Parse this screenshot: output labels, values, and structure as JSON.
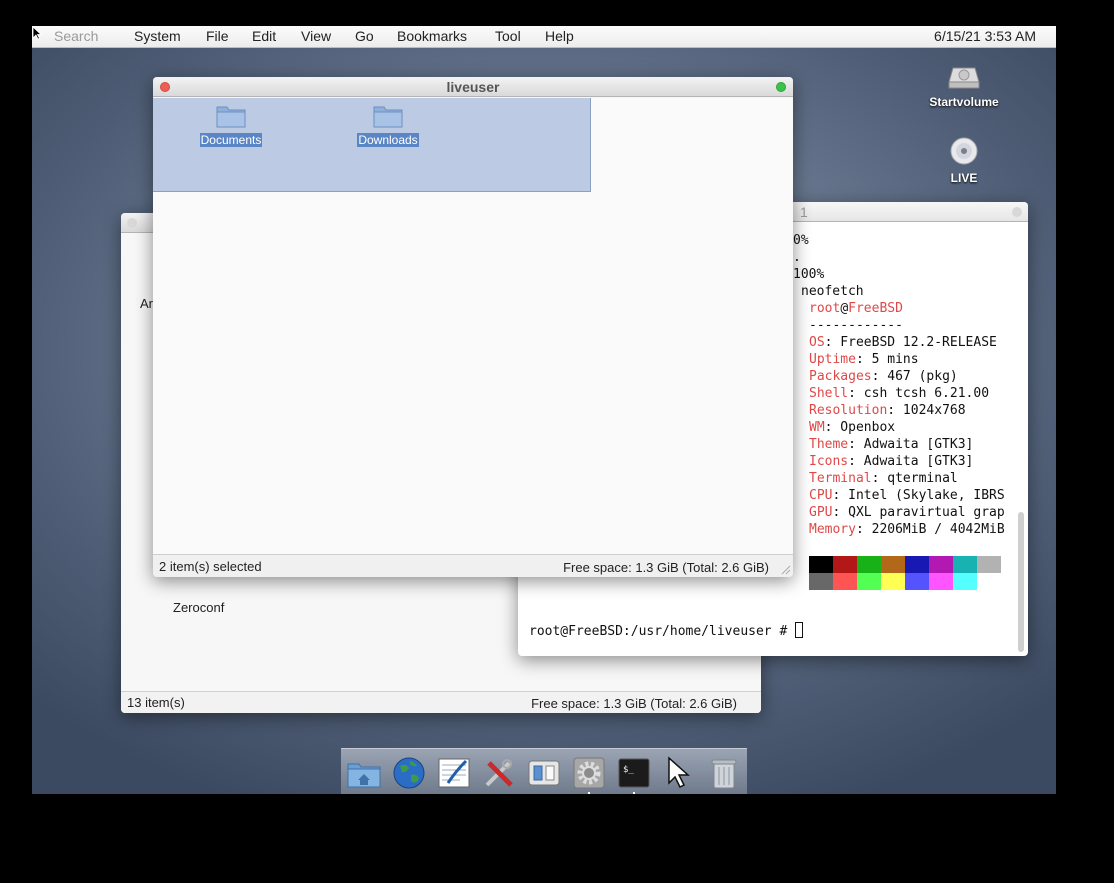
{
  "menubar": {
    "search_placeholder": "Search",
    "items": [
      "System",
      "File",
      "Edit",
      "View",
      "Go",
      "Bookmarks",
      "Tool",
      "Help"
    ],
    "clock": "6/15/21 3:53 AM"
  },
  "desktop_icons": [
    {
      "label": "Startvolume",
      "icon": "hard-drive-icon"
    },
    {
      "label": "LIVE",
      "icon": "cd-icon"
    }
  ],
  "front_window": {
    "title": "liveuser",
    "files": [
      {
        "name": "Documents",
        "icon": "folder-icon"
      },
      {
        "name": "Downloads",
        "icon": "folder-icon"
      }
    ],
    "status_left": "2 item(s) selected",
    "status_right": "Free space: 1.3 GiB (Total: 2.6 GiB)"
  },
  "back_window": {
    "partial_text_1": "Ar",
    "partial_text_2": "Zeroconf",
    "status_left": "13 item(s)",
    "status_right": "Free space: 1.3 GiB (Total: 2.6 GiB)"
  },
  "terminal": {
    "title_fragment": "1",
    "lines_pre": [
      "0%",
      ".",
      "100%",
      "neofetch"
    ],
    "user_host": {
      "user": "root",
      "at": "@",
      "host": "FreeBSD"
    },
    "separator": "------------",
    "info": [
      {
        "key": "OS",
        "value": ": FreeBSD 12.2-RELEASE"
      },
      {
        "key": "Uptime",
        "value": ": 5 mins"
      },
      {
        "key": "Packages",
        "value": ": 467 (pkg)"
      },
      {
        "key": "Shell",
        "value": ": csh tcsh 6.21.00"
      },
      {
        "key": "Resolution",
        "value": ": 1024x768"
      },
      {
        "key": "WM",
        "value": ": Openbox"
      },
      {
        "key": "Theme",
        "value": ": Adwaita [GTK3]"
      },
      {
        "key": "Icons",
        "value": ": Adwaita [GTK3]"
      },
      {
        "key": "Terminal",
        "value": ": qterminal"
      },
      {
        "key": "CPU",
        "value": ": Intel (Skylake, IBRS"
      },
      {
        "key": "GPU",
        "value": ": QXL paravirtual grap"
      },
      {
        "key": "Memory",
        "value": ": 2206MiB / 4042MiB"
      }
    ],
    "palette_row1": [
      "#000000",
      "#b21818",
      "#18b218",
      "#b26818",
      "#1818b2",
      "#b218b2",
      "#18b2b2",
      "#b2b2b2"
    ],
    "palette_row2": [
      "#686868",
      "#ff5454",
      "#54ff54",
      "#ffff54",
      "#5454ff",
      "#ff54ff",
      "#54ffff"
    ],
    "prompt": "root@FreeBSD:/usr/home/liveuser # "
  },
  "dock": [
    {
      "icon": "home-folder-icon"
    },
    {
      "icon": "globe-icon"
    },
    {
      "icon": "text-editor-icon"
    },
    {
      "icon": "utilities-icon"
    },
    {
      "icon": "preferences-icon"
    },
    {
      "icon": "settings-gear-icon"
    },
    {
      "icon": "terminal-icon"
    },
    {
      "icon": "cursor-icon"
    },
    {
      "icon": "trash-icon"
    }
  ]
}
